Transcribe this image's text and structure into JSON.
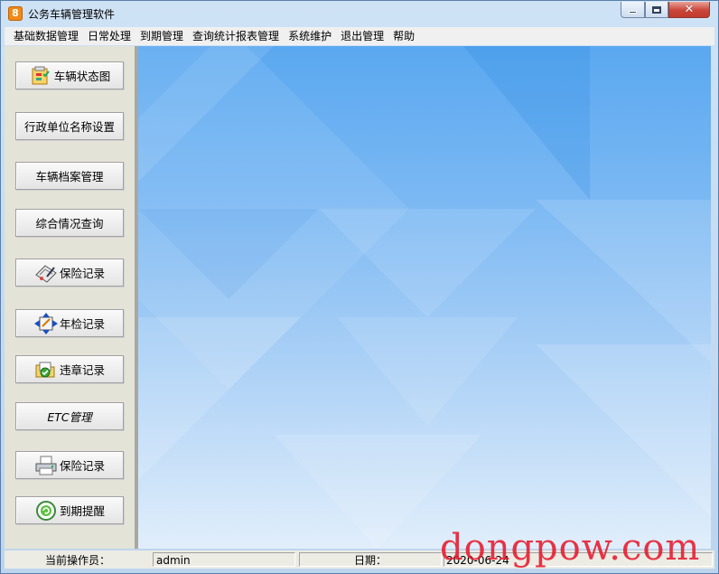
{
  "window": {
    "title": "公务车辆管理软件",
    "app_icon": "app-logo-icon"
  },
  "menu": [
    "基础数据管理",
    "日常处理",
    "到期管理",
    "查询统计报表管理",
    "系统维护",
    "退出管理",
    "帮助"
  ],
  "sidebar": {
    "buttons": [
      {
        "label": "车辆状态图",
        "icon": "vehicle-status-chart-icon"
      },
      {
        "label": "行政单位名称设置",
        "icon": ""
      },
      {
        "label": "车辆档案管理",
        "icon": ""
      },
      {
        "label": "综合情况查询",
        "icon": ""
      },
      {
        "label": "保险记录",
        "icon": "insurance-document-icon"
      },
      {
        "label": "年检记录",
        "icon": "inspection-arrows-icon"
      },
      {
        "label": "违章记录",
        "icon": "violation-folder-icon"
      },
      {
        "label": "ETC管理",
        "icon": ""
      },
      {
        "label": "保险记录",
        "icon": "printer-icon"
      },
      {
        "label": "到期提醒",
        "icon": "reminder-refresh-icon"
      }
    ]
  },
  "status": {
    "operator_label": "当前操作员：",
    "operator_value": "admin",
    "date_label": "日期：",
    "date_value": "2020-06-24"
  },
  "watermark": "dongpow.com",
  "colors": {
    "close_button": "#c9463a",
    "watermark": "#e8192c",
    "desktop_top": "#5aa8f0",
    "desktop_bottom": "#e1eefb"
  }
}
